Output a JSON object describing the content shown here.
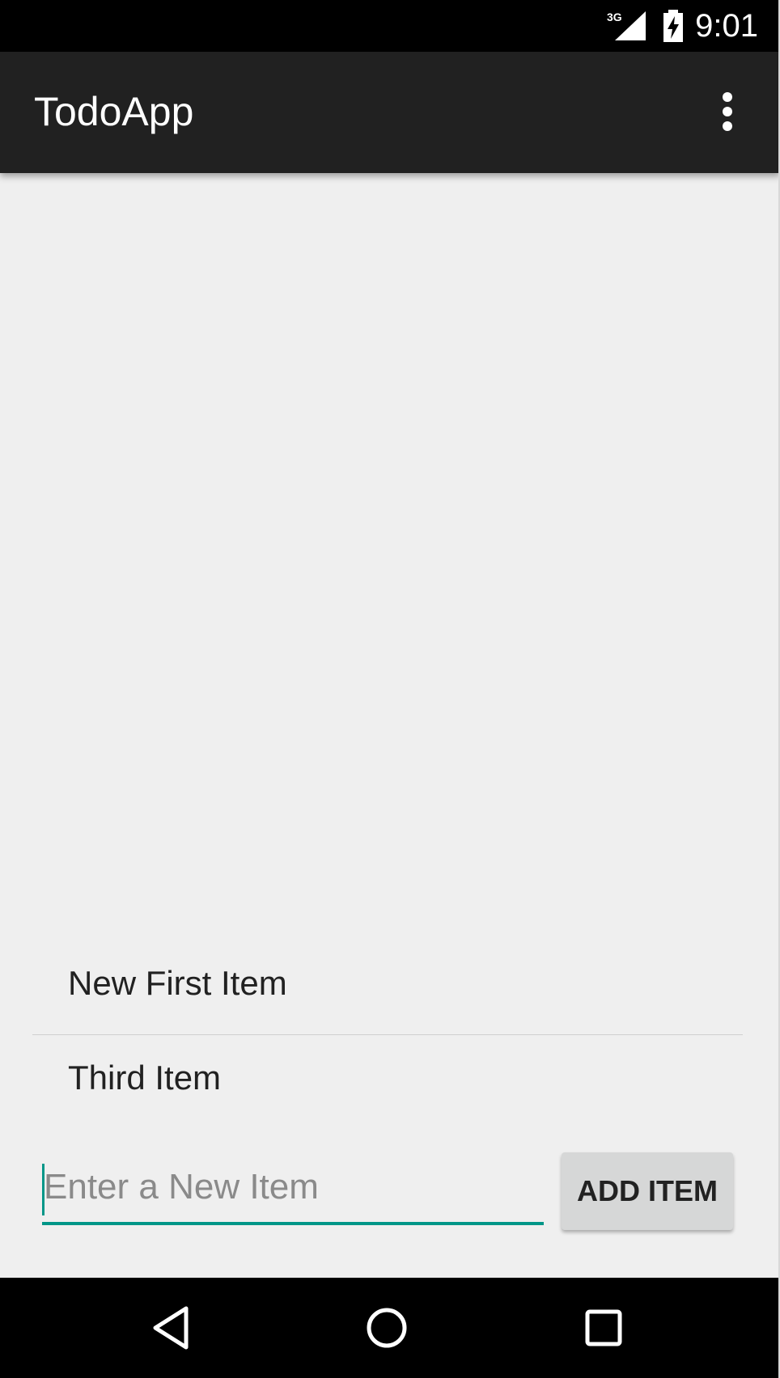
{
  "status_bar": {
    "network": "3G",
    "time": "9:01",
    "icons": [
      "signal-icon",
      "battery-charging-icon"
    ]
  },
  "app_bar": {
    "title": "TodoApp",
    "menu_icon": "more-vert-icon"
  },
  "list": {
    "items": [
      {
        "label": "New First Item"
      },
      {
        "label": "Third Item"
      }
    ]
  },
  "input": {
    "value": "",
    "placeholder": "Enter a New Item"
  },
  "add_button": {
    "label": "ADD ITEM"
  },
  "nav_bar": {
    "icons": [
      "back-icon",
      "home-icon",
      "recents-icon"
    ]
  },
  "colors": {
    "status_bar": "#000000",
    "app_bar": "#212121",
    "background": "#efefef",
    "accent": "#009688",
    "button": "#d6d7d7"
  }
}
